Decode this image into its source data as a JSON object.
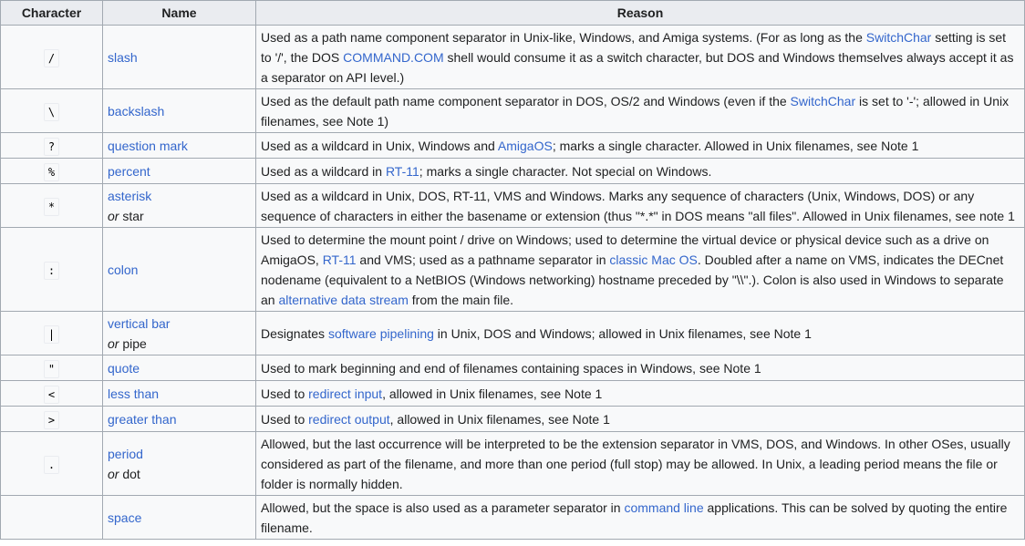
{
  "headers": {
    "character": "Character",
    "name": "Name",
    "reason": "Reason"
  },
  "rows": [
    {
      "char": "/",
      "name": "slash",
      "reason": [
        {
          "t": "Used as a path name component separator in Unix-like, Windows, and Amiga systems. (For as long as the "
        },
        {
          "t": "SwitchChar",
          "link": true
        },
        {
          "t": " setting is set to '/', the DOS "
        },
        {
          "t": "COMMAND.COM",
          "link": true
        },
        {
          "t": " shell would consume it as a switch character, but DOS and Windows themselves always accept it as a separator on API level.)"
        }
      ]
    },
    {
      "char": "\\",
      "name": "backslash",
      "reason": [
        {
          "t": "Used as the default path name component separator in DOS, OS/2 and Windows (even if the "
        },
        {
          "t": "SwitchChar",
          "link": true
        },
        {
          "t": " is set to '-'; allowed in Unix filenames, see Note 1)"
        }
      ]
    },
    {
      "char": "?",
      "name": "question mark",
      "reason": [
        {
          "t": "Used as a wildcard in Unix, Windows and "
        },
        {
          "t": "AmigaOS",
          "link": true
        },
        {
          "t": "; marks a single character. Allowed in Unix filenames, see Note 1"
        }
      ]
    },
    {
      "char": "%",
      "name": "percent",
      "reason": [
        {
          "t": "Used as a wildcard in "
        },
        {
          "t": "RT-11",
          "link": true
        },
        {
          "t": "; marks a single character. Not special on Windows."
        }
      ]
    },
    {
      "char": "*",
      "name": "asterisk",
      "alt_prefix": "or",
      "alt": "star",
      "reason": [
        {
          "t": "Used as a wildcard in Unix, DOS, RT-11, VMS and Windows. Marks any sequence of characters (Unix, Windows, DOS) or any sequence of characters in either the basename or extension (thus \"*.*\" in DOS means \"all files\". Allowed in Unix filenames, see note 1"
        }
      ]
    },
    {
      "char": ":",
      "name": "colon",
      "reason": [
        {
          "t": "Used to determine the mount point / drive on Windows; used to determine the virtual device or physical device such as a drive on AmigaOS, "
        },
        {
          "t": "RT-11",
          "link": true
        },
        {
          "t": " and VMS; used as a pathname separator in "
        },
        {
          "t": "classic Mac OS",
          "link": true
        },
        {
          "t": ". Doubled after a name on VMS, indicates the DECnet nodename (equivalent to a NetBIOS (Windows networking) hostname preceded by \"\\\\\".). Colon is also used in Windows to separate an "
        },
        {
          "t": "alternative data stream",
          "link": true
        },
        {
          "t": " from the main file."
        }
      ]
    },
    {
      "char": "|",
      "name": "vertical bar",
      "alt_prefix": "or",
      "alt": "pipe",
      "reason": [
        {
          "t": "Designates "
        },
        {
          "t": "software pipelining",
          "link": true
        },
        {
          "t": " in Unix, DOS and Windows; allowed in Unix filenames, see Note 1"
        }
      ]
    },
    {
      "char": "\"",
      "name": "quote",
      "reason": [
        {
          "t": "Used to mark beginning and end of filenames containing spaces in Windows, see Note 1"
        }
      ]
    },
    {
      "char": "<",
      "name": "less than",
      "reason": [
        {
          "t": "Used to "
        },
        {
          "t": "redirect input",
          "link": true
        },
        {
          "t": ", allowed in Unix filenames, see Note 1"
        }
      ]
    },
    {
      "char": ">",
      "name": "greater than",
      "reason": [
        {
          "t": "Used to "
        },
        {
          "t": "redirect output",
          "link": true
        },
        {
          "t": ", allowed in Unix filenames, see Note 1"
        }
      ]
    },
    {
      "char": ".",
      "name": "period",
      "alt_prefix": "or",
      "alt": "dot",
      "reason": [
        {
          "t": "Allowed, but the last occurrence will be interpreted to be the extension separator in VMS, DOS, and Windows. In other OSes, usually considered as part of the filename, and more than one period (full stop) may be allowed. In Unix, a leading period means the file or folder is normally hidden."
        }
      ]
    },
    {
      "char": " ",
      "name": "space",
      "reason": [
        {
          "t": "Allowed, but the space is also used as a parameter separator in "
        },
        {
          "t": "command line",
          "link": true
        },
        {
          "t": " applications. This can be solved by quoting the entire filename."
        }
      ]
    }
  ]
}
